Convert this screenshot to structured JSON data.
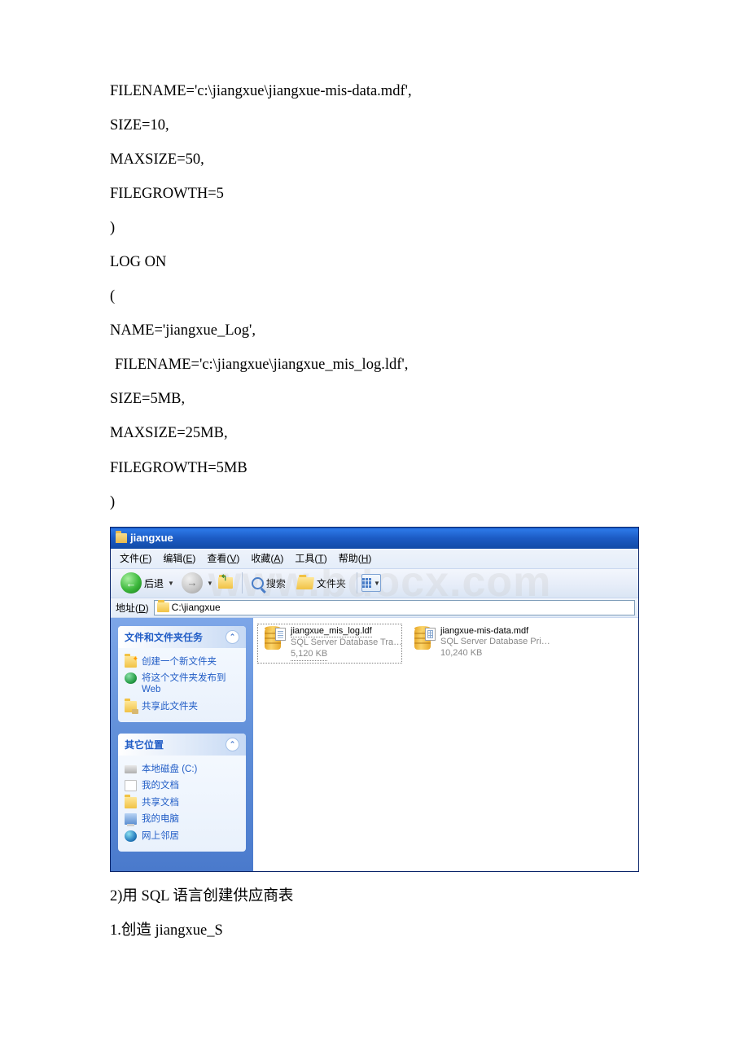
{
  "code": {
    "l1": "FILENAME='c:\\jiangxue\\jiangxue-mis-data.mdf',",
    "l2": "SIZE=10,",
    "l3": "MAXSIZE=50,",
    "l4": "FILEGROWTH=5",
    "l5": ")",
    "l6": "LOG ON",
    "l7": "(",
    "l8": "NAME='jiangxue_Log',",
    "l9": " FILENAME='c:\\jiangxue\\jiangxue_mis_log.ldf',",
    "l10": "SIZE=5MB,",
    "l11": "MAXSIZE=25MB,",
    "l12": "FILEGROWTH=5MB",
    "l13": ")"
  },
  "explorer": {
    "title": "jiangxue",
    "menu": {
      "file": "文件(F)",
      "edit": "编辑(E)",
      "view": "查看(V)",
      "fav": "收藏(A)",
      "tools": "工具(T)",
      "help": "帮助(H)"
    },
    "toolbar": {
      "back": "后退",
      "search": "搜索",
      "folders": "文件夹"
    },
    "address_label": "地址(D)",
    "address_path": "C:\\jiangxue",
    "watermark": "www.bdocx.com",
    "leftpanel": {
      "tasks_header": "文件和文件夹任务",
      "tasks": {
        "new_folder": "创建一个新文件夹",
        "publish_web": "将这个文件夹发布到 Web",
        "share": "共享此文件夹"
      },
      "other_header": "其它位置",
      "other": {
        "local_disk": "本地磁盘 (C:)",
        "my_docs": "我的文档",
        "shared_docs": "共享文档",
        "my_computer": "我的电脑",
        "net_places": "网上邻居"
      }
    },
    "files": {
      "f1": {
        "name": "jiangxue_mis_log.ldf",
        "type": "SQL Server Database Transac...",
        "size": "5,120 KB"
      },
      "f2": {
        "name": "jiangxue-mis-data.mdf",
        "type": "SQL Server Database Primary ...",
        "size": "10,240 KB"
      }
    }
  },
  "after": {
    "line1": "2)用 SQL 语言创建供应商表",
    "line2": "1.创造 jiangxue_S"
  }
}
